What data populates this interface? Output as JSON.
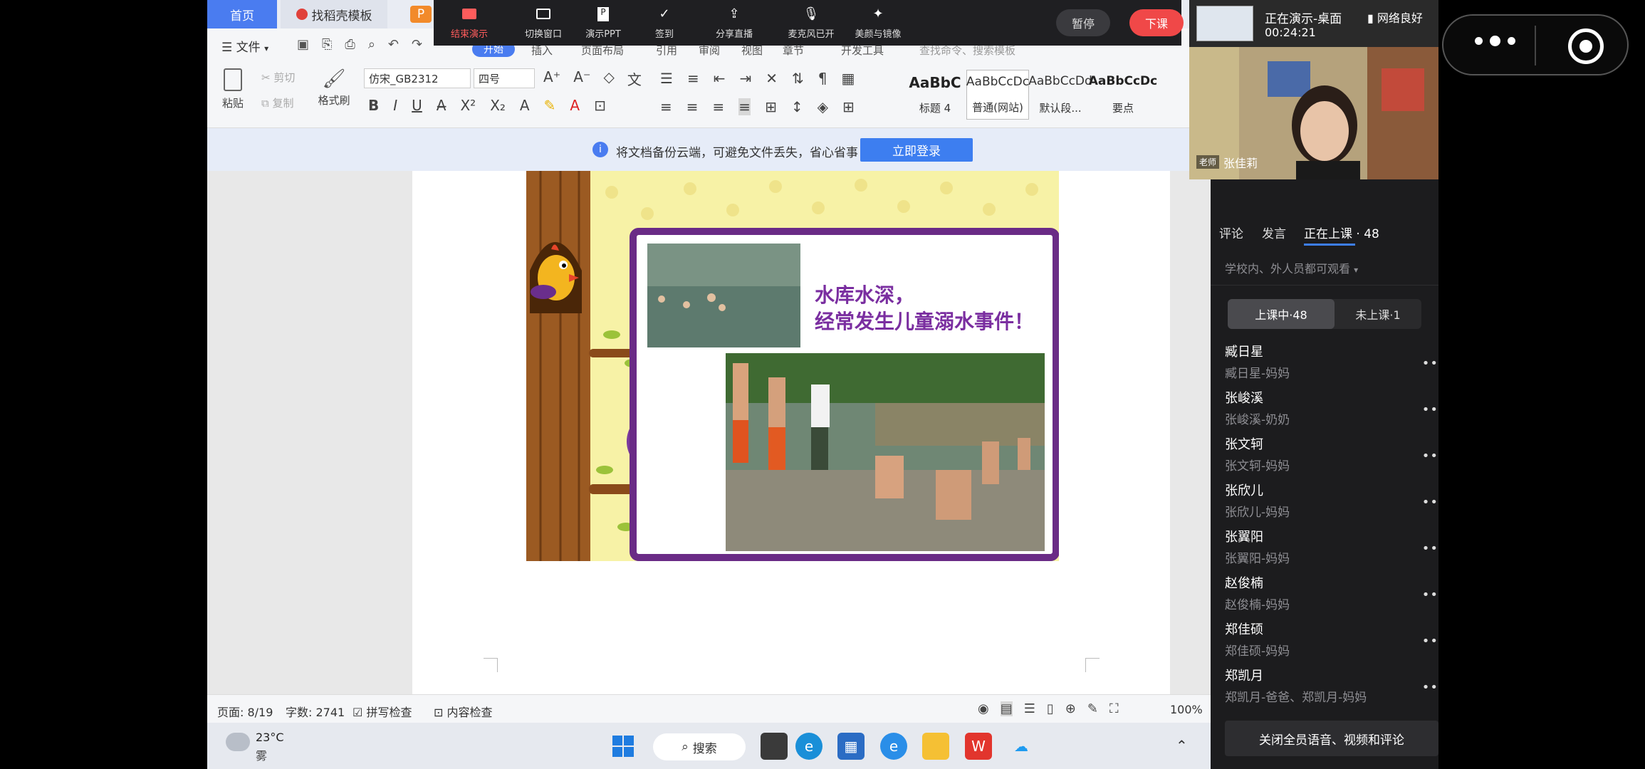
{
  "tabs": {
    "home": "首页",
    "template": "找稻壳模板",
    "ppt_icon": "P"
  },
  "presenter_bar": {
    "buttons": [
      {
        "label": "结束演示",
        "icon": "screen-stop-icon"
      },
      {
        "label": "切换窗口",
        "icon": "window-switch-icon"
      },
      {
        "label": "演示PPT",
        "icon": "ppt-icon"
      },
      {
        "label": "签到",
        "icon": "checkin-icon"
      },
      {
        "label": "分享直播",
        "icon": "share-icon"
      },
      {
        "label": "麦克风已开",
        "icon": "microphone-icon"
      },
      {
        "label": "美颜与镜像",
        "icon": "sparkle-icon"
      }
    ],
    "pause": "暂停",
    "dismiss": "下课"
  },
  "menu": {
    "file": "文件",
    "search_hint": "查找命令、搜索模板",
    "start_tab": "开始",
    "insert": "插入",
    "layout": "页面布局",
    "reference": "引用",
    "review": "审阅",
    "view": "视图",
    "section": "章节",
    "dev": "开发工具"
  },
  "ribbon": {
    "paste": "粘贴",
    "cut": "剪切",
    "copy": "复制",
    "format_painter": "格式刷",
    "font_name": "仿宋_GB2312",
    "font_size": "四号",
    "styles": [
      {
        "preview": "AaBbC",
        "label": "标题 4"
      },
      {
        "preview": "AaBbCcDc",
        "label": "普通(网站)"
      },
      {
        "preview": "AaBbCcDd",
        "label": "默认段..."
      },
      {
        "preview": "AaBbCcDc",
        "label": "要点"
      }
    ]
  },
  "notice": {
    "text": "将文档备份云端，可避免文件丢失，省心省事",
    "button": "立即登录"
  },
  "document": {
    "headline_line1": "水库水深，",
    "headline_line2": "经常发生儿童溺水事件！"
  },
  "statusbar": {
    "page": "页面: 8/19",
    "words": "字数: 2741",
    "spell": "拼写检查",
    "content": "内容检查",
    "zoom": "100%"
  },
  "taskbar": {
    "weather_temp": "23°C",
    "weather_desc": "雾",
    "search": "搜索"
  },
  "live": {
    "status": "正在演示-桌面",
    "time": "00:24:21",
    "network": "网络良好",
    "teacher_tag": "老师",
    "teacher_name": "张佳莉"
  },
  "panel": {
    "tabs": [
      "评论",
      "发言",
      "正在上课 · 48"
    ],
    "visibility": "学校内、外人员都可观看",
    "seg_in": "上课中·48",
    "seg_out": "未上课·1",
    "students": [
      {
        "name": "臧日星",
        "rel": "臧日星-妈妈"
      },
      {
        "name": "张峻溪",
        "rel": "张峻溪-奶奶"
      },
      {
        "name": "张文轲",
        "rel": "张文轲-妈妈"
      },
      {
        "name": "张欣儿",
        "rel": "张欣儿-妈妈"
      },
      {
        "name": "张翼阳",
        "rel": "张翼阳-妈妈"
      },
      {
        "name": "赵俊楠",
        "rel": "赵俊楠-妈妈"
      },
      {
        "name": "郑佳硕",
        "rel": "郑佳硕-妈妈"
      },
      {
        "name": "郑凯月",
        "rel": "郑凯月-爸爸、郑凯月-妈妈"
      }
    ],
    "mute_all": "关闭全员语音、视频和评论"
  },
  "colors": {
    "accent": "#4a7cf0",
    "danger": "#f04848",
    "frame_purple": "#6a2b86",
    "headline_purple": "#7a2ea0"
  }
}
